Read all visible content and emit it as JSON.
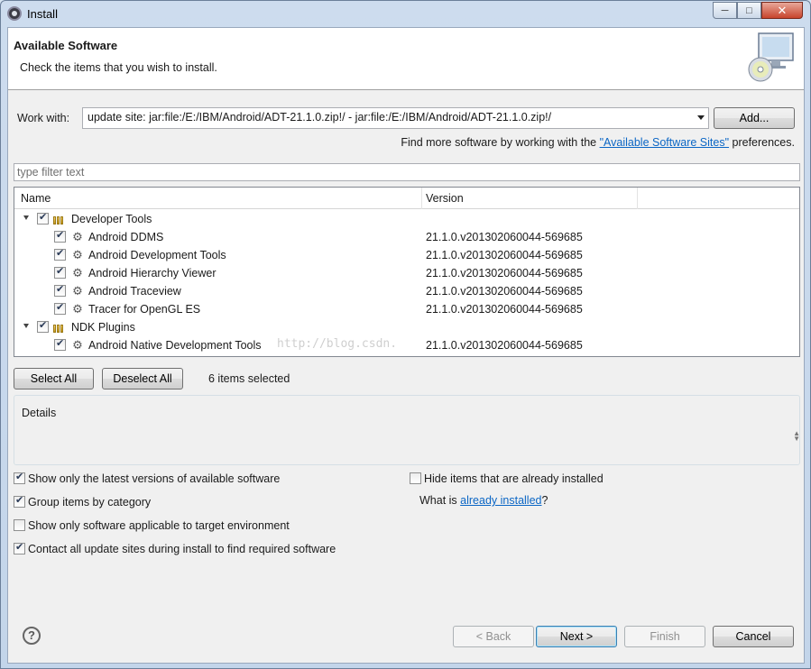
{
  "window": {
    "title": "Install",
    "minimize": "─",
    "maximize": "□",
    "close": "✕"
  },
  "banner": {
    "title": "Available Software",
    "subtitle": "Check the items that you wish to install."
  },
  "work_with": {
    "label": "Work with:",
    "value": "update site: jar:file:/E:/IBM/Android/ADT-21.1.0.zip!/ - jar:file:/E:/IBM/Android/ADT-21.1.0.zip!/",
    "add_button": "Add..."
  },
  "find_more": {
    "prefix": "Find more software by working with the ",
    "link": "\"Available Software Sites\"",
    "suffix": " preferences."
  },
  "filter": {
    "placeholder": "type filter text"
  },
  "table": {
    "columns": [
      "Name",
      "Version"
    ],
    "categories": [
      {
        "name": "Developer Tools",
        "checked": true,
        "items": [
          {
            "name": "Android DDMS",
            "version": "21.1.0.v201302060044-569685",
            "checked": true
          },
          {
            "name": "Android Development Tools",
            "version": "21.1.0.v201302060044-569685",
            "checked": true
          },
          {
            "name": "Android Hierarchy Viewer",
            "version": "21.1.0.v201302060044-569685",
            "checked": true
          },
          {
            "name": "Android Traceview",
            "version": "21.1.0.v201302060044-569685",
            "checked": true
          },
          {
            "name": "Tracer for OpenGL ES",
            "version": "21.1.0.v201302060044-569685",
            "checked": true
          }
        ]
      },
      {
        "name": "NDK Plugins",
        "checked": true,
        "items": [
          {
            "name": "Android Native Development Tools",
            "version": "21.1.0.v201302060044-569685",
            "checked": true
          }
        ]
      }
    ]
  },
  "watermark": "http://blog.csdn.",
  "selection": {
    "select_all": "Select All",
    "deselect_all": "Deselect All",
    "count_text": "6 items selected"
  },
  "details": {
    "label": "Details"
  },
  "options": {
    "latest_versions": {
      "label": "Show only the latest versions of available software",
      "checked": true
    },
    "group_by_category": {
      "label": "Group items by category",
      "checked": true
    },
    "target_env": {
      "label": "Show only software applicable to target environment",
      "checked": false
    },
    "contact_sites": {
      "label": "Contact all update sites during install to find required software",
      "checked": true
    },
    "hide_installed": {
      "label": "Hide items that are already installed",
      "checked": false
    },
    "already_installed": {
      "prefix": "What is ",
      "link": "already installed",
      "suffix": "?"
    }
  },
  "footer": {
    "back": "< Back",
    "next": "Next >",
    "finish": "Finish",
    "cancel": "Cancel"
  },
  "colors": {
    "link": "#0b66c5",
    "window_frame": "#c3d5ea",
    "dialog_bg": "#f0f0f0"
  }
}
